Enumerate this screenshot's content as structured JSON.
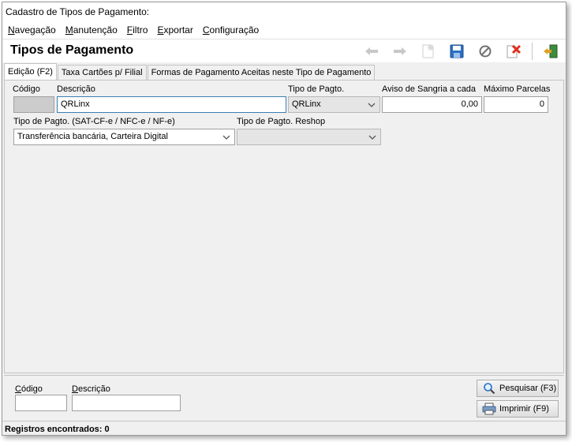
{
  "window": {
    "title": "Cadastro de Tipos de Pagamento:"
  },
  "menu": [
    {
      "label": "Navegação",
      "key": "N",
      "rest": "avegação"
    },
    {
      "label": "Manutenção",
      "key": "M",
      "rest": "anutenção"
    },
    {
      "label": "Filtro",
      "key": "F",
      "rest": "iltro"
    },
    {
      "label": "Exportar",
      "key": "E",
      "rest": "xportar"
    },
    {
      "label": "Configuração",
      "key": "C",
      "rest": "onfiguração"
    }
  ],
  "header": {
    "title": "Tipos de Pagamento"
  },
  "toolbar": {
    "icons": [
      "arrow-left-icon",
      "arrow-right-icon",
      "new-record-icon",
      "save-icon",
      "cancel-icon",
      "delete-icon",
      "exit-icon"
    ]
  },
  "tabs": [
    {
      "label": "Edição (F2)",
      "active": true
    },
    {
      "label": "Taxa Cartões p/ Filial",
      "active": false
    },
    {
      "label": "Formas de Pagamento Aceitas neste Tipo de Pagamento",
      "active": false
    }
  ],
  "form": {
    "codigo": {
      "label": "Código",
      "value": ""
    },
    "descricao": {
      "label": "Descrição",
      "value": "QRLinx"
    },
    "tipo_pagto": {
      "label": "Tipo de Pagto.",
      "value": "QRLinx"
    },
    "aviso_sangria": {
      "label": "Aviso de Sangria a cada",
      "value": "0,00"
    },
    "maximo_parcelas": {
      "label": "Máximo Parcelas",
      "value": "0"
    },
    "tipo_pagto_sat": {
      "label": "Tipo de Pagto. (SAT-CF-e / NFC-e / NF-e)",
      "value": "Transferência bancária, Carteira Digital"
    },
    "tipo_pagto_reshop": {
      "label": "Tipo de Pagto. Reshop",
      "value": ""
    }
  },
  "search": {
    "codigo": {
      "label_key": "C",
      "label_rest": "ódigo",
      "value": ""
    },
    "descricao": {
      "label_key": "D",
      "label_rest": "escrição",
      "value": ""
    },
    "pesquisar_label": "Pesquisar (F3)",
    "imprimir_label": "Imprimir (F9)"
  },
  "status": {
    "text": "Registros encontrados: 0"
  },
  "colors": {
    "accent": "#3c7fb1",
    "panel": "#f0f0f0",
    "disabled": "#cccccc"
  }
}
